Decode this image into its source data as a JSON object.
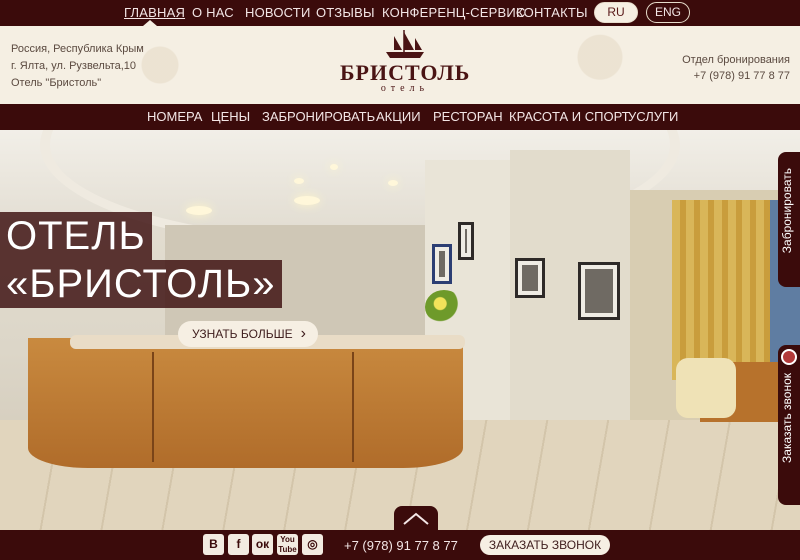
{
  "top_nav": {
    "items": [
      "ГЛАВНАЯ",
      "О НАС",
      "НОВОСТИ",
      "ОТЗЫВЫ",
      "КОНФЕРЕНЦ-СЕРВИС",
      "КОНТАКТЫ"
    ],
    "active": "ГЛАВНАЯ",
    "languages": [
      "RU",
      "ENG"
    ],
    "active_language": "RU"
  },
  "header": {
    "address_lines": [
      "Россия, Республика Крым",
      "г. Ялта, ул. Рузвельта,10",
      "Отель \"Бристоль\""
    ],
    "logo_name": "БРИСТОЛЬ",
    "logo_subtitle": "отель",
    "booking_label": "Отдел бронирования",
    "booking_phone": "+7 (978) 91 77 8 77"
  },
  "main_nav": {
    "items": [
      "НОМЕРА",
      "ЦЕНЫ",
      "ЗАБРОНИРОВАТЬ",
      "АКЦИИ",
      "РЕСТОРАН",
      "КРАСОТА И СПОРТ",
      "УСЛУГИ"
    ]
  },
  "hero": {
    "title_line1": "ОТЕЛЬ",
    "title_line2": "«БРИСТОЛЬ»",
    "more_button": "УЗНАТЬ БОЛЬШЕ"
  },
  "side_tabs": {
    "book": "Забронировать",
    "call": "Заказать звонок"
  },
  "bottom_bar": {
    "social": [
      {
        "icon": "vk-icon",
        "glyph": "В"
      },
      {
        "icon": "facebook-icon",
        "glyph": "f"
      },
      {
        "icon": "odnoklassniki-icon",
        "glyph": "ок"
      },
      {
        "icon": "youtube-icon",
        "glyph": "You Tube"
      },
      {
        "icon": "instagram-icon",
        "glyph": "◎"
      }
    ],
    "phone": "+7 (978) 91 77 8 77",
    "call_button": "ЗАКАЗАТЬ ЗВОНОК"
  },
  "colors": {
    "brand_dark": "#3b0b0b",
    "cream": "#f6efe3"
  }
}
